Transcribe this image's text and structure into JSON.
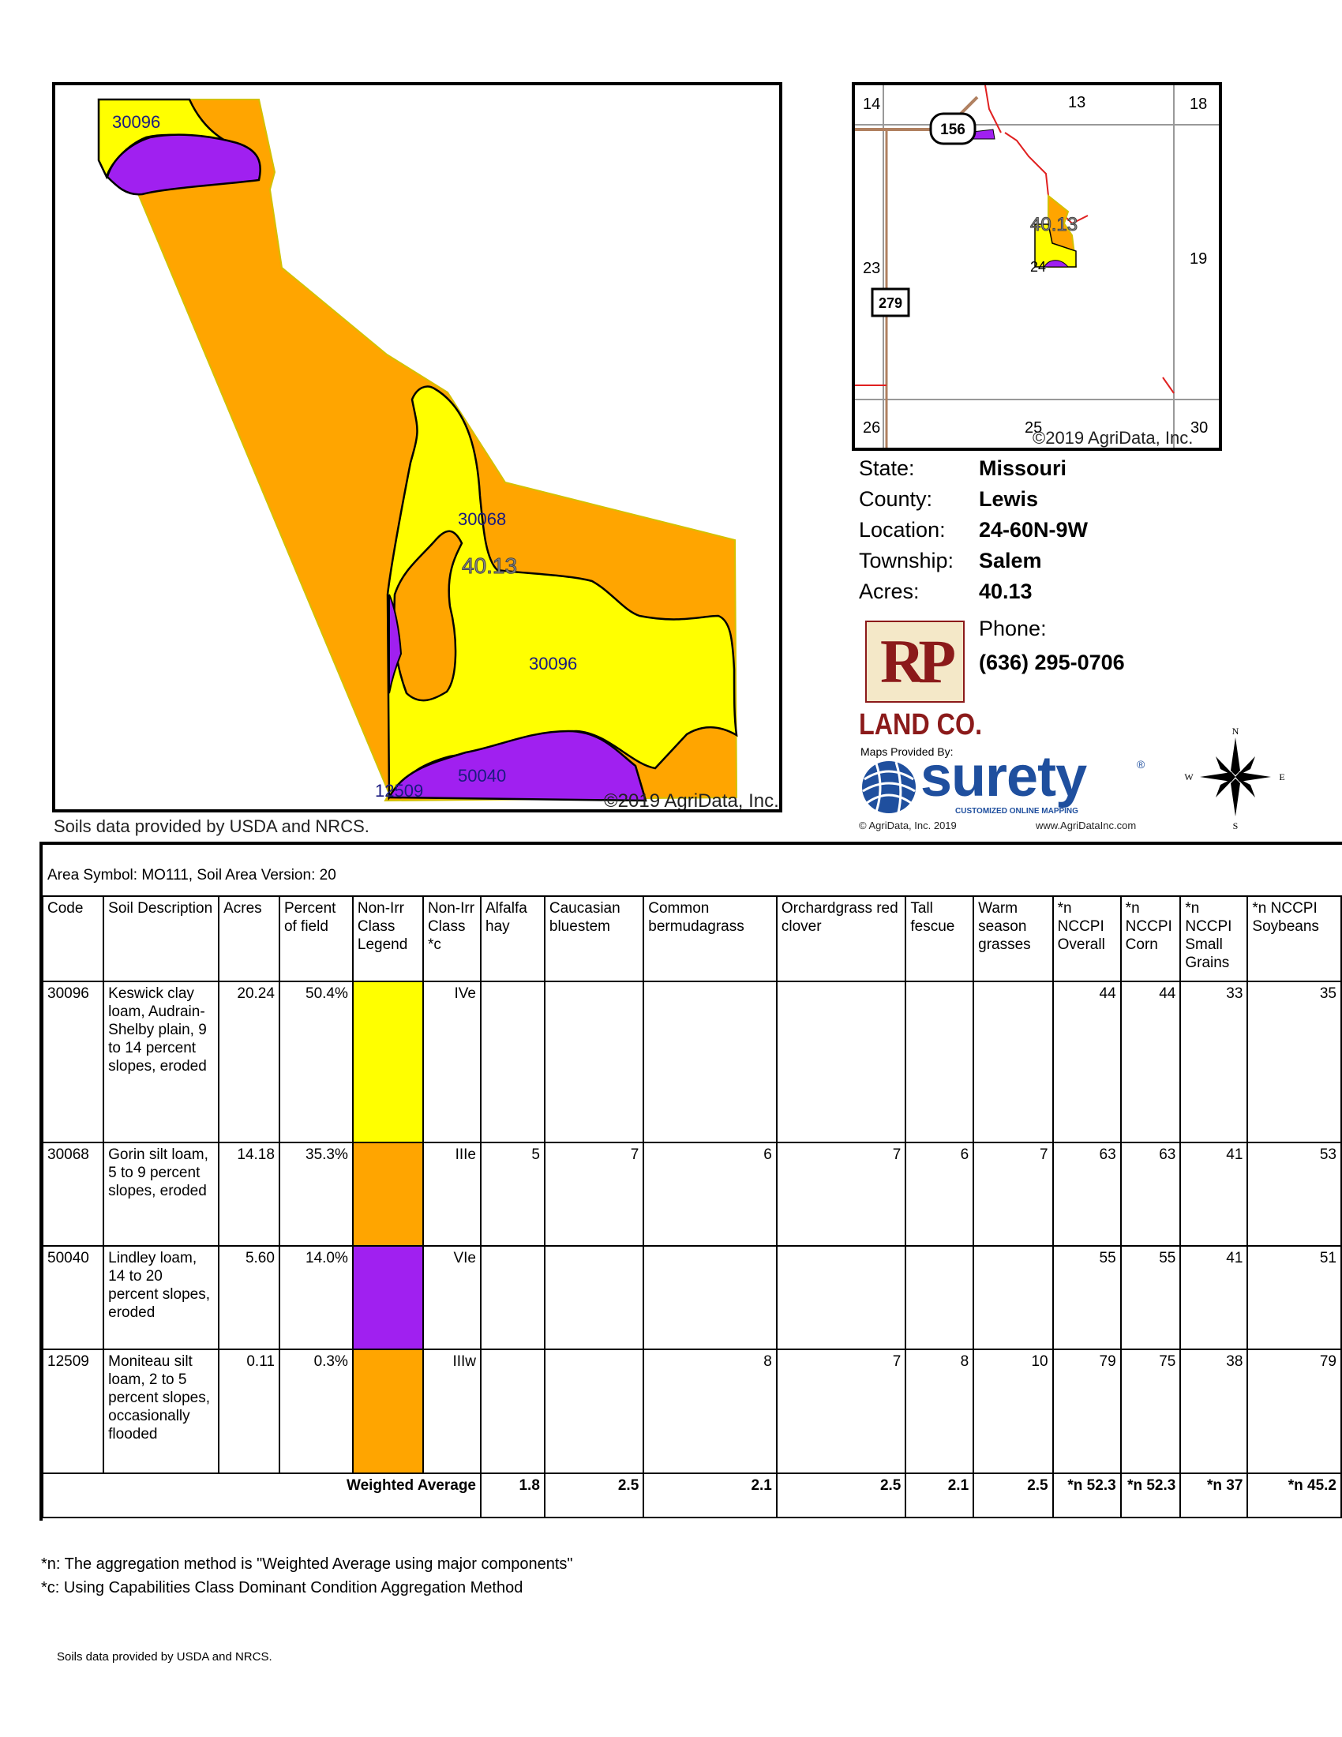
{
  "map": {
    "soil_labels": {
      "a": "30096",
      "b": "30068",
      "c": "30096",
      "d": "50040",
      "e": "12509"
    },
    "acres_label": "40.13",
    "copyright": "©2019 AgriData, Inc."
  },
  "soils_credit": "Soils data provided by USDA and NRCS.",
  "locator": {
    "sections": {
      "s14": "14",
      "s13": "13",
      "s18": "18",
      "s23": "23",
      "s24": "24",
      "s19": "19",
      "s26": "26",
      "s25": "25",
      "s30": "30"
    },
    "route_156": "156",
    "route_279": "279",
    "acres_label": "40.13",
    "copyright": "©2019 AgriData, Inc."
  },
  "info": {
    "state_label": "State:",
    "state": "Missouri",
    "county_label": "County:",
    "county": "Lewis",
    "location_label": "Location:",
    "location": "24-60N-9W",
    "township_label": "Township:",
    "township": "Salem",
    "acres_label": "Acres:",
    "acres": "40.13",
    "phone_label": "Phone:",
    "phone": "(636) 295-0706"
  },
  "branding": {
    "rp_mark": "RP",
    "land_co": "LAND CO.",
    "maps_provided_by": "Maps Provided By:",
    "surety": "surety",
    "registered": "®",
    "surety_tagline": "CUSTOMIZED ONLINE MAPPING",
    "agridata_copyright": "© AgriData, Inc. 2019",
    "website": "www.AgriDataInc.com"
  },
  "compass": {
    "n": "N",
    "s": "S",
    "e": "E",
    "w": "W"
  },
  "table": {
    "area_symbol": "Area Symbol: MO111, Soil Area Version: 20",
    "headers": [
      "Code",
      "Soil Description",
      "Acres",
      "Percent of field",
      "Non-Irr Class Legend",
      "Non-Irr Class *c",
      "Alfalfa hay",
      "Caucasian bluestem",
      "Common bermudagrass",
      "Orchardgrass red clover",
      "Tall fescue",
      "Warm season grasses",
      "*n NCCPI Overall",
      "*n NCCPI Corn",
      "*n NCCPI Small Grains",
      "*n NCCPI Soybeans"
    ],
    "rows": [
      {
        "code": "30096",
        "desc": "Keswick clay loam, Audrain-Shelby plain, 9 to 14 percent slopes, eroded",
        "acres": "20.24",
        "pct": "50.4%",
        "legend_color": "#ffff00",
        "cls": "IVe",
        "alfalfa": "",
        "caucasian": "",
        "bermuda": "",
        "orchard": "",
        "fescue": "",
        "warm": "",
        "nccpi": "44",
        "corn": "44",
        "small": "33",
        "soy": "35"
      },
      {
        "code": "30068",
        "desc": "Gorin silt loam, 5 to 9 percent slopes, eroded",
        "acres": "14.18",
        "pct": "35.3%",
        "legend_color": "#ffa500",
        "cls": "IIIe",
        "alfalfa": "5",
        "caucasian": "7",
        "bermuda": "6",
        "orchard": "7",
        "fescue": "6",
        "warm": "7",
        "nccpi": "63",
        "corn": "63",
        "small": "41",
        "soy": "53"
      },
      {
        "code": "50040",
        "desc": "Lindley loam, 14 to 20 percent slopes, eroded",
        "acres": "5.60",
        "pct": "14.0%",
        "legend_color": "#a020f0",
        "cls": "VIe",
        "alfalfa": "",
        "caucasian": "",
        "bermuda": "",
        "orchard": "",
        "fescue": "",
        "warm": "",
        "nccpi": "55",
        "corn": "55",
        "small": "41",
        "soy": "51"
      },
      {
        "code": "12509",
        "desc": "Moniteau silt loam, 2 to 5 percent slopes, occasionally flooded",
        "acres": "0.11",
        "pct": "0.3%",
        "legend_color": "#ffa500",
        "cls": "IIIw",
        "alfalfa": "",
        "caucasian": "",
        "bermuda": "8",
        "orchard": "7",
        "fescue": "8",
        "warm": "10",
        "nccpi": "79",
        "corn": "75",
        "small": "38",
        "soy": "79"
      }
    ],
    "weighted": {
      "label": "Weighted Average",
      "alfalfa": "1.8",
      "caucasian": "2.5",
      "bermuda": "2.1",
      "orchard": "2.5",
      "fescue": "2.1",
      "warm": "2.5",
      "nccpi": "*n 52.3",
      "corn": "*n 52.3",
      "small": "*n 37",
      "soy": "*n 45.2"
    }
  },
  "footnotes": {
    "n": "*n: The aggregation method is \"Weighted Average using major components\"",
    "c": "*c:  Using Capabilities Class Dominant Condition Aggregation Method"
  },
  "bottom_credit": "Soils data provided by USDA and NRCS."
}
